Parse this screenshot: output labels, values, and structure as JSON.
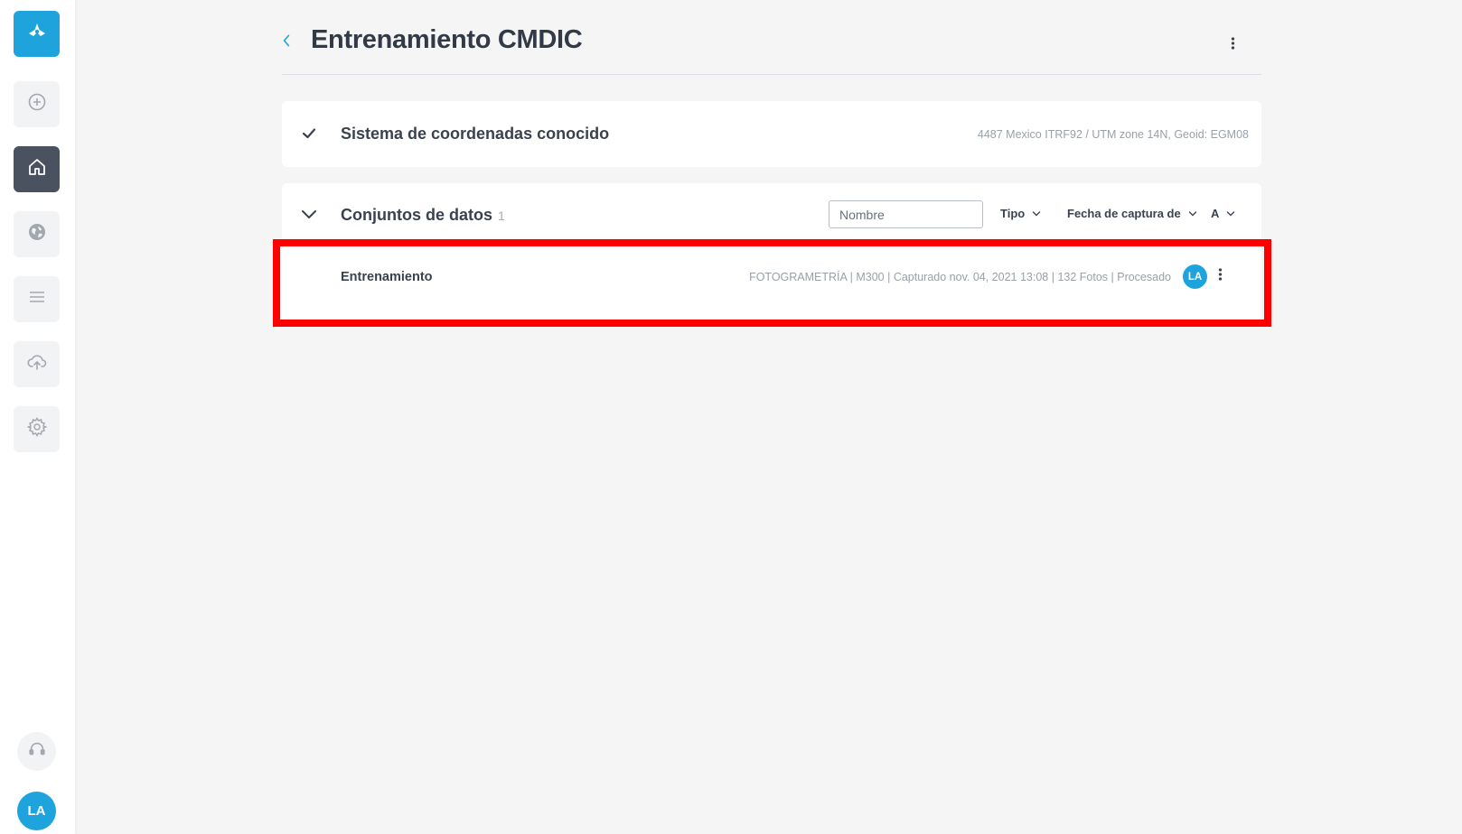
{
  "app": {
    "brand_color": "#1fa3dc",
    "highlight_color": "#ff0000"
  },
  "sidebar": {
    "items": [
      {
        "name": "logo",
        "icon": "drone-logo-icon"
      },
      {
        "name": "new-project",
        "icon": "plus-circle-icon"
      },
      {
        "name": "home",
        "icon": "home-icon",
        "active": true
      },
      {
        "name": "explore",
        "icon": "globe-icon"
      },
      {
        "name": "list",
        "icon": "list-icon"
      },
      {
        "name": "upload",
        "icon": "cloud-upload-icon"
      },
      {
        "name": "settings",
        "icon": "gear-icon"
      }
    ],
    "support_icon": "headset-icon",
    "user_initials": "LA"
  },
  "header": {
    "title": "Entrenamiento CMDIC"
  },
  "coordinate_system": {
    "title": "Sistema de coordenadas conocido",
    "value": "4487 Mexico ITRF92 / UTM zone 14N, Geoid: EGM08"
  },
  "datasets": {
    "title": "Conjuntos de datos",
    "count": "1",
    "search_placeholder": "Nombre",
    "filters": {
      "type": "Tipo",
      "date": "Fecha de captura de",
      "order": "A"
    },
    "rows": [
      {
        "name": "Entrenamiento",
        "meta": "FOTOGRAMETRÍA | M300 | Capturado nov. 04, 2021 13:08 | 132 Fotos | Procesado",
        "owner_initials": "LA"
      }
    ]
  }
}
